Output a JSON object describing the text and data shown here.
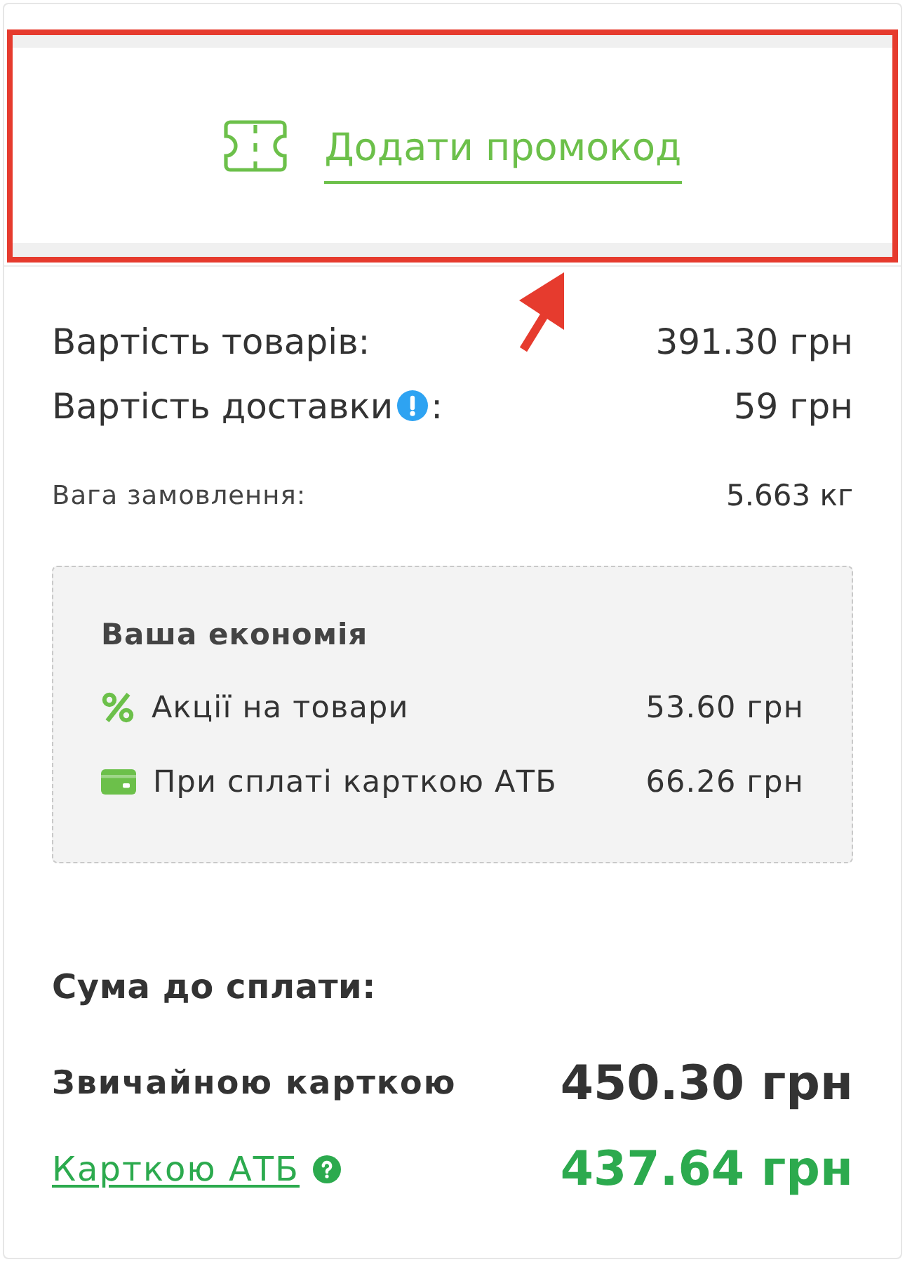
{
  "promo": {
    "label": "Додати промокод"
  },
  "summary": {
    "rows": [
      {
        "kind": "main",
        "label": "Вартість товарів:",
        "value": "391.30 грн"
      },
      {
        "kind": "main",
        "label": "Вартість доставки",
        "info": true,
        "suffix": ":",
        "value": "59 грн"
      },
      {
        "kind": "minor",
        "label": "Вага замовлення:",
        "value": "5.663 кг"
      }
    ]
  },
  "savings": {
    "title": "Ваша економія",
    "items": [
      {
        "kind": "percent",
        "label": "Акції на товари",
        "value": "53.60 грн"
      },
      {
        "kind": "card",
        "label": "При сплаті карткою АТБ",
        "value": "66.26 грн"
      }
    ]
  },
  "total": {
    "title": "Сума до сплати:",
    "options": [
      {
        "kind": "regular",
        "label": "Звичайною карткою",
        "amount": "450.30 грн"
      },
      {
        "kind": "atb",
        "label": "Карткою АТБ",
        "help": true,
        "amount": "437.64 грн"
      }
    ]
  }
}
